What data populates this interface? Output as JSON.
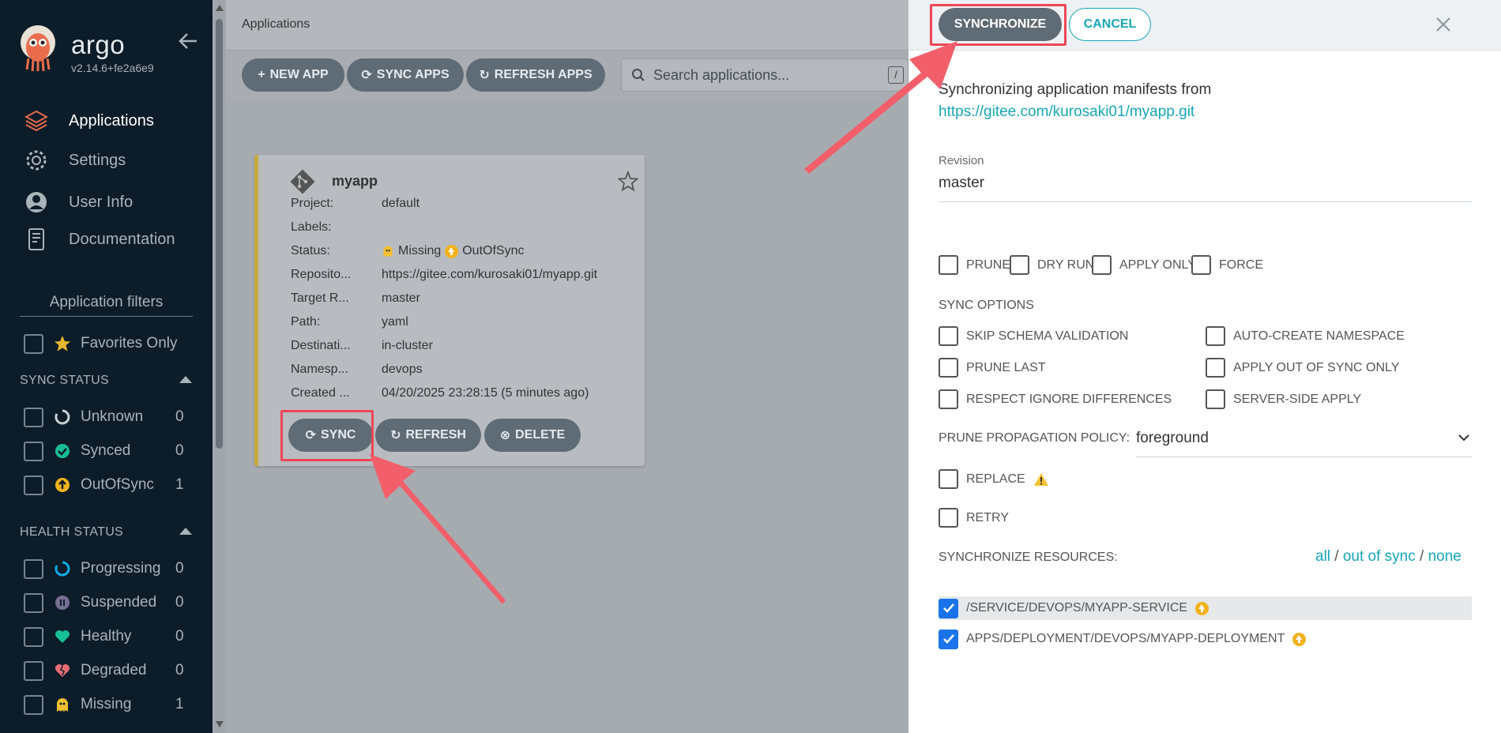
{
  "sidebar": {
    "brand": "argo",
    "version": "v2.14.6+fe2a6e9",
    "nav": [
      {
        "label": "Applications",
        "icon": "layers-icon"
      },
      {
        "label": "Settings",
        "icon": "gear-icon"
      },
      {
        "label": "User Info",
        "icon": "user-icon"
      },
      {
        "label": "Documentation",
        "icon": "document-icon"
      }
    ],
    "filters_title": "Application filters",
    "favorites_label": "Favorites Only",
    "sync_status": {
      "title": "SYNC STATUS",
      "items": [
        {
          "label": "Unknown",
          "count": "0",
          "icon": "circle-notch-icon"
        },
        {
          "label": "Synced",
          "count": "0",
          "icon": "check-circle-icon"
        },
        {
          "label": "OutOfSync",
          "count": "1",
          "icon": "arrow-up-circle-icon"
        }
      ]
    },
    "health_status": {
      "title": "HEALTH STATUS",
      "items": [
        {
          "label": "Progressing",
          "count": "0",
          "icon": "spinner-icon"
        },
        {
          "label": "Suspended",
          "count": "0",
          "icon": "pause-circle-icon"
        },
        {
          "label": "Healthy",
          "count": "0",
          "icon": "heart-icon"
        },
        {
          "label": "Degraded",
          "count": "0",
          "icon": "heart-broken-icon"
        },
        {
          "label": "Missing",
          "count": "1",
          "icon": "ghost-icon"
        }
      ]
    }
  },
  "header": {
    "title": "Applications"
  },
  "toolbar": {
    "new_app": "NEW APP",
    "sync_apps": "SYNC APPS",
    "refresh_apps": "REFRESH APPS",
    "search_placeholder": "Search applications...",
    "search_shortcut": "/"
  },
  "app_card": {
    "name": "myapp",
    "rows": [
      {
        "key": "Project:",
        "value": "default"
      },
      {
        "key": "Labels:",
        "value": ""
      },
      {
        "key": "Status:",
        "value": ""
      },
      {
        "key": "Reposito...",
        "value": "https://gitee.com/kurosaki01/myapp.git"
      },
      {
        "key": "Target R...",
        "value": "master"
      },
      {
        "key": "Path:",
        "value": "yaml"
      },
      {
        "key": "Destinati...",
        "value": "in-cluster"
      },
      {
        "key": "Namesp...",
        "value": "devops"
      },
      {
        "key": "Created ...",
        "value": "04/20/2025 23:28:15  (5 minutes ago)"
      }
    ],
    "health": "Missing",
    "sync": "OutOfSync",
    "buttons": {
      "sync": "SYNC",
      "refresh": "REFRESH",
      "delete": "DELETE"
    },
    "accent_color": "#c7a93f"
  },
  "sync_panel": {
    "synchronize": "SYNCHRONIZE",
    "cancel": "CANCEL",
    "intro": "Synchronizing application manifests from",
    "repo_url": "https://gitee.com/kurosaki01/myapp.git",
    "revision_label": "Revision",
    "revision_value": "master",
    "flags": [
      "PRUNE",
      "DRY RUN",
      "APPLY ONLY",
      "FORCE"
    ],
    "sync_options_title": "SYNC OPTIONS",
    "sync_options": [
      {
        "label": "SKIP SCHEMA VALIDATION",
        "checked": false
      },
      {
        "label": "AUTO-CREATE NAMESPACE",
        "checked": false
      },
      {
        "label": "PRUNE LAST",
        "checked": false
      },
      {
        "label": "APPLY OUT OF SYNC ONLY",
        "checked": false
      },
      {
        "label": "RESPECT IGNORE DIFFERENCES",
        "checked": false
      },
      {
        "label": "SERVER-SIDE APPLY",
        "checked": false
      }
    ],
    "prune_policy_label": "PRUNE PROPAGATION POLICY:",
    "prune_policy_value": "foreground",
    "replace_label": "REPLACE",
    "retry_label": "RETRY",
    "resources_title": "SYNCHRONIZE RESOURCES:",
    "resources_links": {
      "all": "all",
      "out_of_sync": "out of sync",
      "none": "none",
      "sep": "/"
    },
    "resources": [
      {
        "label": "/SERVICE/DEVOPS/MYAPP-SERVICE",
        "checked": true
      },
      {
        "label": "APPS/DEPLOYMENT/DEVOPS/MYAPP-DEPLOYMENT",
        "checked": true
      }
    ]
  },
  "colors": {
    "sidebar_bg": "#0c1c28",
    "button_bg": "#5f6b75",
    "accent_teal": "#17a6b8",
    "highlight_red": "#ee4657",
    "out_of_sync": "#f3b21c",
    "checkbox_blue": "#1a73e8"
  }
}
